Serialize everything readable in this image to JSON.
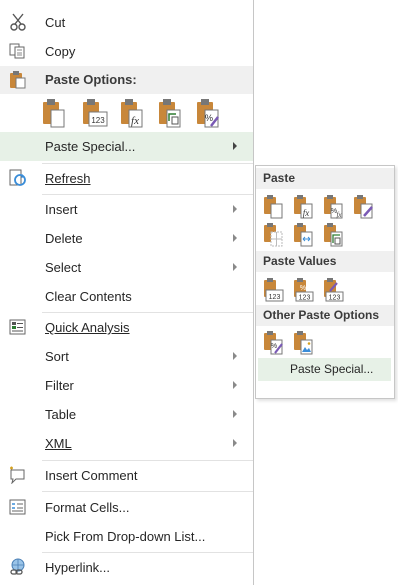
{
  "context_menu": {
    "cut": "Cut",
    "copy": "Copy",
    "paste_options_header": "Paste Options:",
    "paste_special": "Paste Special...",
    "refresh": "Refresh",
    "insert": "Insert",
    "delete": "Delete",
    "select": "Select",
    "clear_contents": "Clear Contents",
    "quick_analysis": "Quick Analysis",
    "sort": "Sort",
    "filter": "Filter",
    "table": "Table",
    "xml": "XML",
    "insert_comment": "Insert Comment",
    "format_cells": "Format Cells...",
    "pick_from_list": "Pick From Drop-down List...",
    "hyperlink": "Hyperlink..."
  },
  "paste_icons": {
    "values_text": "123",
    "formula_text": "fx",
    "percent_text": "%"
  },
  "submenu": {
    "paste_header": "Paste",
    "paste_values_header": "Paste Values",
    "other_header": "Other Paste Options",
    "paste_special": "Paste Special...",
    "values_text": "123",
    "percent_text": "%",
    "formula_text": "fx"
  },
  "colors": {
    "highlight": "#e7f1e7",
    "clipboard_brown": "#c8873a",
    "section_bg": "#f0f0f0"
  }
}
